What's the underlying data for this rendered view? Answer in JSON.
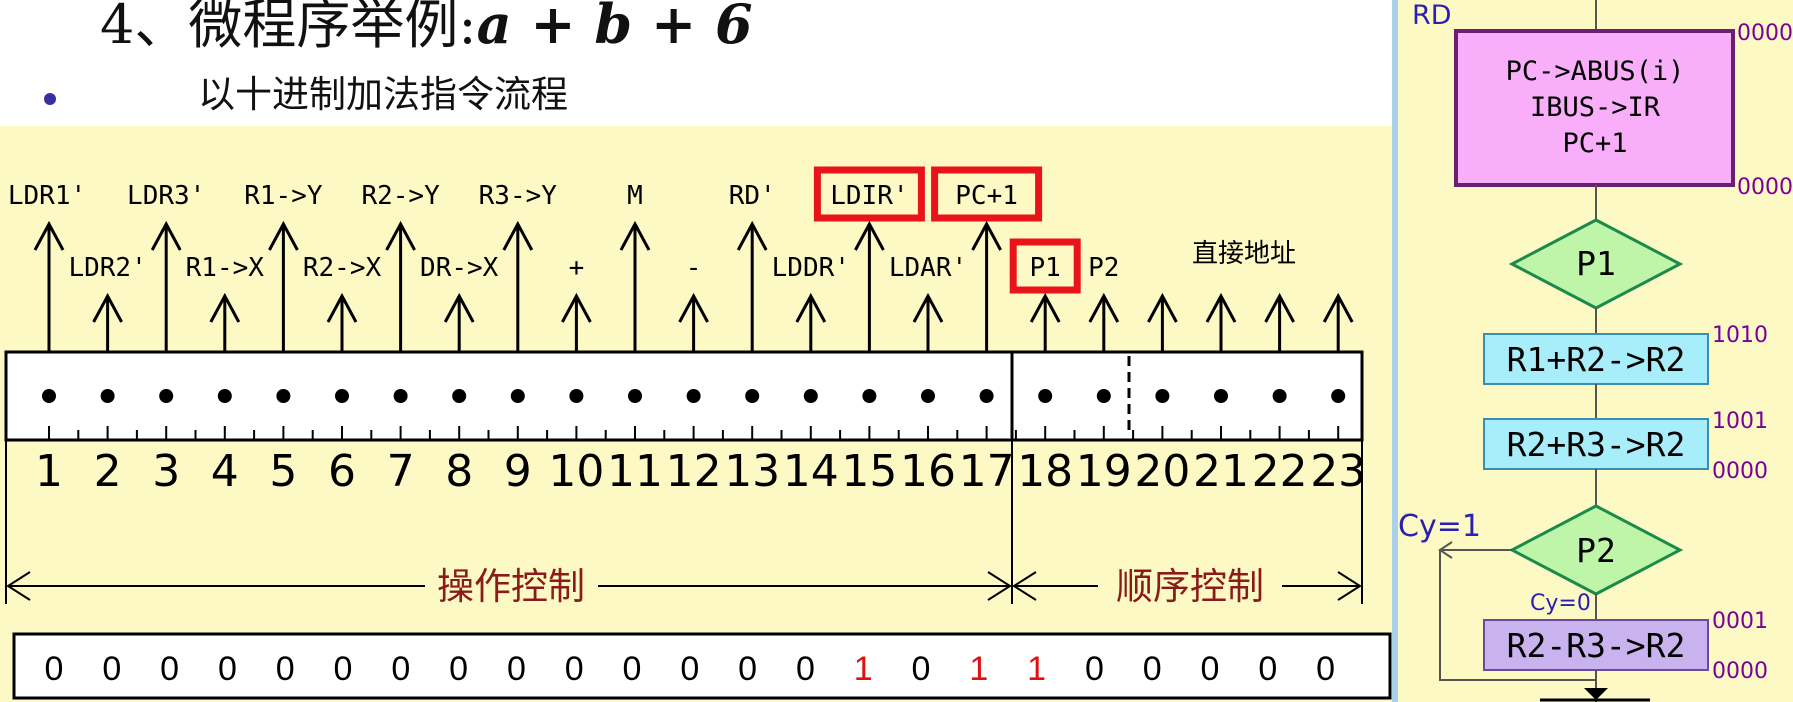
{
  "title": {
    "prefix": "4、微程序举例:",
    "expression": "a + b + 6"
  },
  "subtitle": "以十进制加法指令流程",
  "microword": {
    "top_signals": [
      "LDR1'",
      "LDR3'",
      "R1->Y",
      "R2->Y",
      "R3->Y",
      "M",
      "RD'",
      "LDIR'",
      "PC+1"
    ],
    "lower_signals": [
      "LDR2'",
      "R1->X",
      "R2->X",
      "DR->X",
      "+",
      "-",
      "LDDR'",
      "LDAR'",
      "P1",
      "P2"
    ],
    "direct_address": "直接地址",
    "bit_numbers": [
      "1",
      "2",
      "3",
      "4",
      "5",
      "6",
      "7",
      "8",
      "9",
      "10",
      "11",
      "12",
      "13",
      "14",
      "15",
      "16",
      "17",
      "18",
      "19",
      "20",
      "21",
      "22",
      "23"
    ],
    "section_operation": "操作控制",
    "section_sequence": "顺序控制",
    "bits": [
      "0",
      "0",
      "0",
      "0",
      "0",
      "0",
      "0",
      "0",
      "0",
      "0",
      "0",
      "0",
      "0",
      "0",
      "1",
      "0",
      "1",
      "1",
      "0",
      "0",
      "0",
      "0",
      "0"
    ],
    "highlight_color": "#e8141a",
    "bit_highlight_color": "#e01010"
  },
  "flowchart": {
    "rd_label": "RD",
    "box1": [
      "PC->ABUS(i)",
      "IBUS->IR",
      "PC+1"
    ],
    "box1_addr_top": "0000",
    "box1_addr_bottom": "0000",
    "diamond1": "P1",
    "box2": "R1+R2->R2",
    "box2_addr": "1010",
    "box3": "R2+R3->R2",
    "box3_addr_top": "1001",
    "box3_addr_bottom": "0000",
    "cy1": "Cy=1",
    "diamond2": "P2",
    "cy0": "Cy=0",
    "box4": "R2-R3->R2",
    "box4_addr_top": "0001",
    "box4_addr_bottom": "0000",
    "colors": {
      "box1_fill": "#f9aef9",
      "box1_border": "#6a2070",
      "diamond_fill": "#bff5a8",
      "diamond_border": "#1c8a4a",
      "box_cyan": "#a8eefa",
      "box_purple": "#c8b3ee"
    }
  }
}
